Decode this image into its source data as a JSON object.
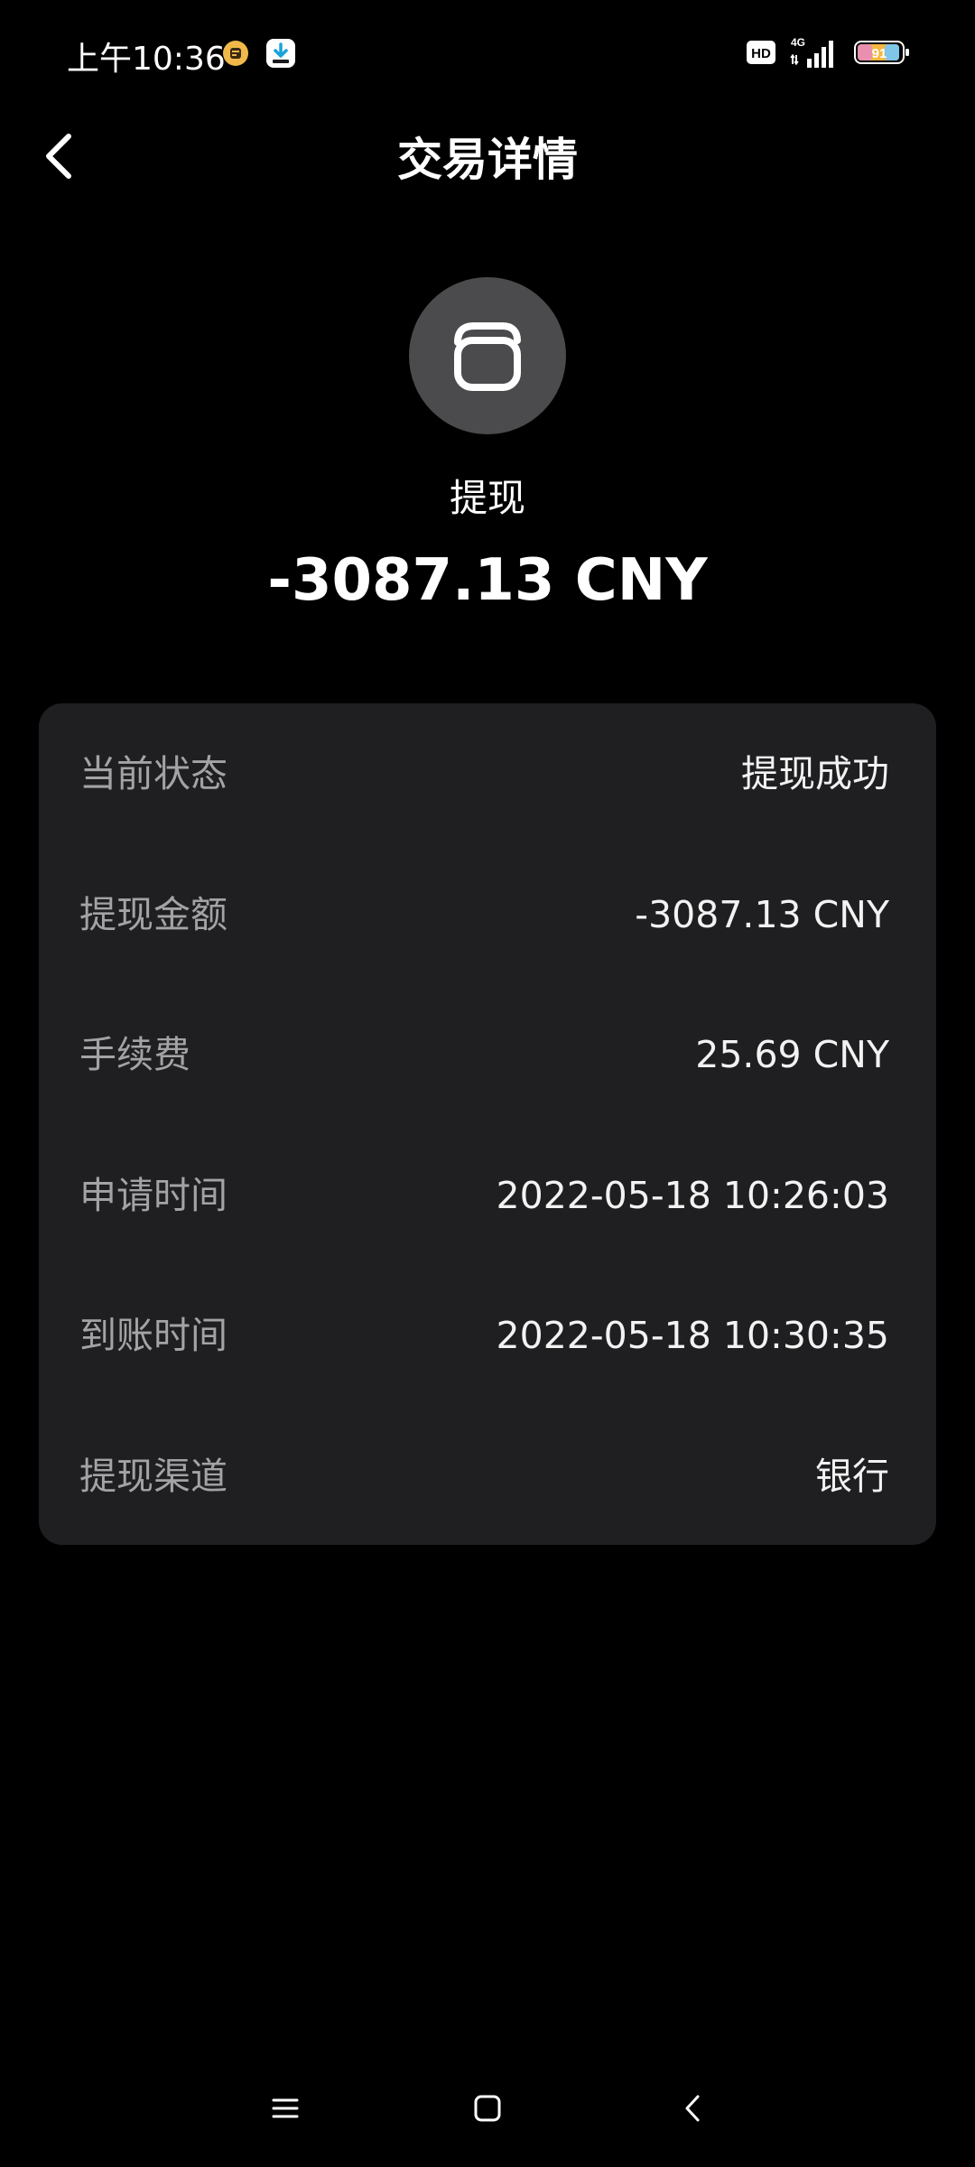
{
  "status_bar": {
    "time": "上午10:36",
    "icons": [
      "notification-app-icon",
      "download-icon",
      "hd-icon",
      "signal-4g-icon",
      "battery-icon"
    ],
    "network": "4G",
    "battery_level": "91"
  },
  "header": {
    "title": "交易详情",
    "back_icon": "chevron-left-icon"
  },
  "summary": {
    "icon": "wallet-icon",
    "type": "提现",
    "amount": "-3087.13 CNY"
  },
  "details": [
    {
      "label": "当前状态",
      "value": "提现成功"
    },
    {
      "label": "提现金额",
      "value": "-3087.13 CNY"
    },
    {
      "label": "手续费",
      "value": "25.69 CNY"
    },
    {
      "label": "申请时间",
      "value": "2022-05-18 10:26:03"
    },
    {
      "label": "到账时间",
      "value": "2022-05-18 10:30:35"
    },
    {
      "label": "提现渠道",
      "value": "银行"
    }
  ],
  "nav_bar": {
    "icons": [
      "menu-icon",
      "home-square-icon",
      "back-triangle-icon"
    ]
  },
  "colors": {
    "background": "#000000",
    "card": "#1f1f21",
    "icon_circle": "#4b4b4d",
    "label": "#a3a3a6",
    "value": "#f2f2f2"
  }
}
